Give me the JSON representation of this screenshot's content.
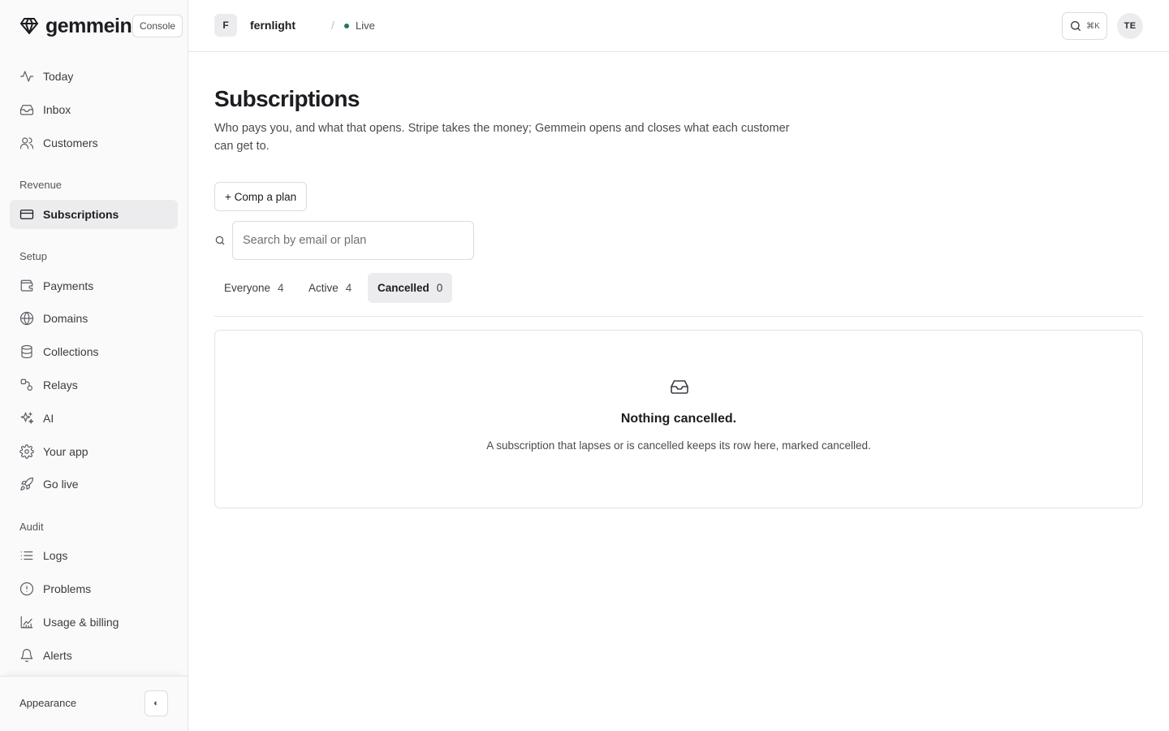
{
  "brand": {
    "name": "gemmein",
    "console_label": "Console"
  },
  "sidebar": {
    "primary": [
      {
        "label": "Today",
        "icon": "activity-icon"
      },
      {
        "label": "Inbox",
        "icon": "inbox-icon"
      },
      {
        "label": "Customers",
        "icon": "users-icon"
      }
    ],
    "sections": [
      {
        "title": "Revenue",
        "items": [
          {
            "label": "Subscriptions",
            "icon": "credit-card-icon",
            "active": true
          }
        ]
      },
      {
        "title": "Setup",
        "items": [
          {
            "label": "Payments",
            "icon": "wallet-icon"
          },
          {
            "label": "Domains",
            "icon": "globe-icon"
          },
          {
            "label": "Collections",
            "icon": "database-icon"
          },
          {
            "label": "Relays",
            "icon": "route-icon"
          },
          {
            "label": "AI",
            "icon": "sparkles-icon"
          },
          {
            "label": "Your app",
            "icon": "gear-icon"
          },
          {
            "label": "Go live",
            "icon": "rocket-icon"
          }
        ]
      },
      {
        "title": "Audit",
        "items": [
          {
            "label": "Logs",
            "icon": "list-icon"
          },
          {
            "label": "Problems",
            "icon": "alert-circle-icon"
          },
          {
            "label": "Usage & billing",
            "icon": "chart-line-icon"
          },
          {
            "label": "Alerts",
            "icon": "bell-icon"
          }
        ]
      }
    ],
    "footer": {
      "appearance_label": "Appearance",
      "toggle_glyph": "◐"
    }
  },
  "topbar": {
    "project_initial": "F",
    "project_name": "fernlight",
    "separator": "/",
    "environment": "Live",
    "environment_color": "#1f7a54",
    "search_shortcut": "⌘K",
    "user_initials": "TE"
  },
  "main": {
    "title": "Subscriptions",
    "description": "Who pays you, and what that opens. Stripe takes the money; Gemmein opens and closes what each customer can get to.",
    "comp_button": "+ Comp a plan",
    "search": {
      "placeholder": "Search by email or plan",
      "value": ""
    },
    "tabs": [
      {
        "label": "Everyone",
        "count": "4",
        "active": false
      },
      {
        "label": "Active",
        "count": "4",
        "active": false
      },
      {
        "label": "Cancelled",
        "count": "0",
        "active": true
      }
    ],
    "empty_state": {
      "icon": "inbox-icon",
      "title": "Nothing cancelled.",
      "description": "A subscription that lapses or is cancelled keeps its row here, marked cancelled."
    }
  }
}
